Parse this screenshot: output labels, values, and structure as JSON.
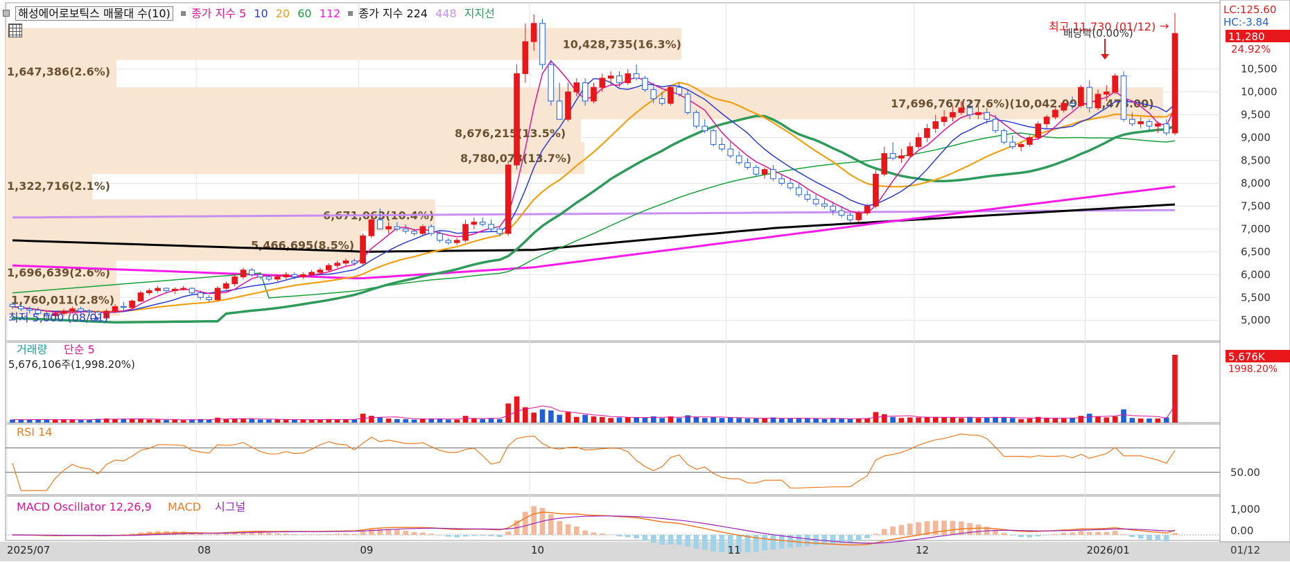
{
  "header": {
    "title": "해성에어로보틱스 매물대 수(10)",
    "ma_label": "종가 지수",
    "ma_periods": [
      "5",
      "10",
      "20",
      "60",
      "112"
    ],
    "ma2_label": "종가 지수",
    "ma2_periods": [
      "224",
      "448"
    ],
    "support_label": "지지선"
  },
  "colors": {
    "bull": "#e8171b",
    "bear": "#1f5fd8",
    "profile": "#f8e6d2",
    "ma5": "#e0119a",
    "ma10": "#2a3bd6",
    "ma20": "#f0a010",
    "ma60": "#16a03a",
    "ma112": "#f81ae8",
    "ma224": "#000000",
    "ma448": "#c78ff0",
    "support": "#2e9b5a",
    "grid": "#e3e3e3",
    "axis_bg": "#d9d9d9"
  },
  "right_axis": {
    "lc": "LC:125.60",
    "hc": "HC:-3.84",
    "last_price": "11,280",
    "last_change": "24.92%",
    "ticks": [
      "10,500",
      "10,000",
      "9,500",
      "9,000",
      "8,500",
      "8,000",
      "7,500",
      "7,000",
      "6,500",
      "6,000",
      "5,500",
      "5,000"
    ]
  },
  "annotations": {
    "high": "최고 11,730 (01/12)",
    "low": "최저 5,000 (08/01)",
    "dividend": "배당락(0.00%)"
  },
  "volume_profile": [
    {
      "label": "10,428,735(16.3%)"
    },
    {
      "label": "1,647,386(2.6%)"
    },
    {
      "label": "17,696,767(27.6%)(10,042.00 ~ 9,478.00)"
    },
    {
      "label": "8,676,215(13.5%)"
    },
    {
      "label": "8,780,073(13.7%)"
    },
    {
      "label": "1,322,716(2.1%)"
    },
    {
      "label": "6,671,063(10.4%)"
    },
    {
      "label": "5,466,695(8.5%)"
    },
    {
      "label": "1,696,639(2.6%)"
    },
    {
      "label": "1,760,011(2.8%)"
    }
  ],
  "volume_panel": {
    "title": "거래량",
    "ma_label": "단순 5",
    "value": "5,676,106주(1,998.20%)",
    "badge": "5,676K",
    "badge_pct": "1998.20%"
  },
  "rsi_panel": {
    "title": "RSI 14",
    "tick": "50.00"
  },
  "macd_panel": {
    "title": "MACD Oscillator 12,26,9",
    "macd_label": "MACD",
    "signal_label": "시그널",
    "ticks": [
      "1,000",
      "0.00"
    ]
  },
  "x_axis": {
    "labels": [
      "2025/07",
      "08",
      "09",
      "10",
      "11",
      "12",
      "2026/01"
    ],
    "end_label": "01/12"
  },
  "chart_data": {
    "type": "candlestick",
    "y_range": [
      4700,
      11800
    ],
    "candles": [
      [
        5350,
        5400,
        5250,
        5300
      ],
      [
        5300,
        5350,
        5200,
        5250
      ],
      [
        5250,
        5300,
        5150,
        5220
      ],
      [
        5220,
        5280,
        5100,
        5150
      ],
      [
        5150,
        5200,
        5050,
        5100
      ],
      [
        5100,
        5180,
        5050,
        5150
      ],
      [
        5150,
        5250,
        5100,
        5200
      ],
      [
        5200,
        5300,
        5150,
        5250
      ],
      [
        5250,
        5300,
        5150,
        5200
      ],
      [
        5200,
        5250,
        5100,
        5180
      ],
      [
        5180,
        5220,
        5000,
        5050
      ],
      [
        5050,
        5250,
        5000,
        5200
      ],
      [
        5200,
        5350,
        5150,
        5300
      ],
      [
        5300,
        5400,
        5200,
        5280
      ],
      [
        5280,
        5450,
        5250,
        5420
      ],
      [
        5420,
        5650,
        5400,
        5600
      ],
      [
        5600,
        5700,
        5550,
        5650
      ],
      [
        5650,
        5750,
        5600,
        5700
      ],
      [
        5700,
        5720,
        5600,
        5650
      ],
      [
        5650,
        5720,
        5580,
        5680
      ],
      [
        5680,
        5750,
        5650,
        5700
      ],
      [
        5700,
        5720,
        5550,
        5600
      ],
      [
        5600,
        5650,
        5450,
        5500
      ],
      [
        5500,
        5550,
        5400,
        5450
      ],
      [
        5450,
        5750,
        5420,
        5700
      ],
      [
        5700,
        5850,
        5650,
        5800
      ],
      [
        5800,
        6000,
        5750,
        5950
      ],
      [
        5950,
        6150,
        5900,
        6100
      ],
      [
        6100,
        6150,
        5950,
        6000
      ],
      [
        6000,
        6050,
        5900,
        5950
      ],
      [
        5950,
        6000,
        5850,
        5900
      ],
      [
        5900,
        6000,
        5850,
        5950
      ],
      [
        5950,
        6050,
        5900,
        6000
      ],
      [
        6000,
        6050,
        5900,
        5950
      ],
      [
        5950,
        6050,
        5900,
        6000
      ],
      [
        6000,
        6100,
        5950,
        6050
      ],
      [
        6050,
        6150,
        6000,
        6100
      ],
      [
        6100,
        6250,
        6050,
        6200
      ],
      [
        6200,
        6300,
        6150,
        6250
      ],
      [
        6250,
        6350,
        6200,
        6300
      ],
      [
        6300,
        6350,
        6200,
        6250
      ],
      [
        6250,
        6900,
        6200,
        6850
      ],
      [
        6850,
        7300,
        6800,
        7200
      ],
      [
        7200,
        7450,
        7100,
        7000
      ],
      [
        7000,
        7150,
        6900,
        7050
      ],
      [
        7050,
        7150,
        6950,
        7000
      ],
      [
        7000,
        7100,
        6900,
        6950
      ],
      [
        6950,
        7000,
        6850,
        6900
      ],
      [
        6900,
        7100,
        6850,
        7050
      ],
      [
        7050,
        7100,
        6850,
        6900
      ],
      [
        6900,
        6950,
        6700,
        6750
      ],
      [
        6750,
        6800,
        6650,
        6700
      ],
      [
        6700,
        6800,
        6650,
        6750
      ],
      [
        6750,
        7200,
        6700,
        7100
      ],
      [
        7100,
        7250,
        7000,
        7150
      ],
      [
        7150,
        7250,
        7050,
        7100
      ],
      [
        7100,
        7200,
        6950,
        7000
      ],
      [
        7000,
        7050,
        6850,
        6900
      ],
      [
        6900,
        8500,
        6850,
        8400
      ],
      [
        8400,
        10600,
        8300,
        10400
      ],
      [
        10400,
        11500,
        10200,
        11100
      ],
      [
        11100,
        11700,
        10900,
        11500
      ],
      [
        11500,
        11600,
        10500,
        10600
      ],
      [
        10600,
        10700,
        9700,
        9800
      ],
      [
        9800,
        10200,
        9600,
        9400
      ],
      [
        9400,
        10200,
        9350,
        10000
      ],
      [
        10000,
        10300,
        9900,
        10200
      ],
      [
        10200,
        10300,
        9700,
        9800
      ],
      [
        9800,
        10200,
        9750,
        10100
      ],
      [
        10100,
        10400,
        10000,
        10300
      ],
      [
        10300,
        10450,
        10150,
        10350
      ],
      [
        10350,
        10450,
        10100,
        10200
      ],
      [
        10200,
        10500,
        10150,
        10400
      ],
      [
        10400,
        10600,
        10250,
        10300
      ],
      [
        10300,
        10350,
        10000,
        10050
      ],
      [
        10050,
        10200,
        9750,
        9850
      ],
      [
        9850,
        10000,
        9700,
        9750
      ],
      [
        9750,
        10150,
        9700,
        10100
      ],
      [
        10100,
        10200,
        9900,
        9950
      ],
      [
        9950,
        10050,
        9500,
        9550
      ],
      [
        9550,
        9600,
        9200,
        9250
      ],
      [
        9250,
        9400,
        9100,
        9150
      ],
      [
        9150,
        9200,
        8800,
        8850
      ],
      [
        8850,
        9000,
        8700,
        8750
      ],
      [
        8750,
        8900,
        8550,
        8600
      ],
      [
        8600,
        8700,
        8400,
        8450
      ],
      [
        8450,
        8550,
        8300,
        8350
      ],
      [
        8350,
        8400,
        8150,
        8200
      ],
      [
        8200,
        8350,
        8100,
        8300
      ],
      [
        8300,
        8400,
        8050,
        8100
      ],
      [
        8100,
        8200,
        7950,
        8000
      ],
      [
        8000,
        8100,
        7850,
        7900
      ],
      [
        7900,
        8000,
        7700,
        7750
      ],
      [
        7750,
        7850,
        7600,
        7650
      ],
      [
        7650,
        7750,
        7500,
        7550
      ],
      [
        7550,
        7650,
        7450,
        7500
      ],
      [
        7500,
        7600,
        7300,
        7400
      ],
      [
        7400,
        7500,
        7250,
        7300
      ],
      [
        7300,
        7350,
        7150,
        7200
      ],
      [
        7200,
        7400,
        7150,
        7350
      ],
      [
        7350,
        7550,
        7300,
        7500
      ],
      [
        7500,
        8300,
        7450,
        8200
      ],
      [
        8200,
        8800,
        8150,
        8650
      ],
      [
        8650,
        8900,
        8500,
        8550
      ],
      [
        8550,
        8750,
        8450,
        8600
      ],
      [
        8600,
        8900,
        8550,
        8800
      ],
      [
        8800,
        9100,
        8750,
        9000
      ],
      [
        9000,
        9300,
        8900,
        9200
      ],
      [
        9200,
        9500,
        9100,
        9350
      ],
      [
        9350,
        9600,
        9250,
        9450
      ],
      [
        9450,
        9700,
        9350,
        9550
      ],
      [
        9550,
        9800,
        9500,
        9650
      ],
      [
        9650,
        9800,
        9400,
        9500
      ],
      [
        9500,
        9700,
        9400,
        9550
      ],
      [
        9550,
        9650,
        9300,
        9400
      ],
      [
        9400,
        9500,
        9100,
        9150
      ],
      [
        9150,
        9200,
        8850,
        8900
      ],
      [
        8900,
        9050,
        8750,
        8800
      ],
      [
        8800,
        8900,
        8700,
        8850
      ],
      [
        8850,
        9050,
        8800,
        9000
      ],
      [
        9000,
        9350,
        8950,
        9300
      ],
      [
        9300,
        9500,
        9200,
        9450
      ],
      [
        9450,
        9650,
        9400,
        9600
      ],
      [
        9600,
        9800,
        9550,
        9750
      ],
      [
        9750,
        9900,
        9600,
        9700
      ],
      [
        9700,
        10150,
        9650,
        10100
      ],
      [
        10100,
        10250,
        9550,
        9650
      ],
      [
        9650,
        10050,
        9600,
        9950
      ],
      [
        9950,
        10150,
        9800,
        10000
      ],
      [
        10000,
        10400,
        9950,
        10350
      ],
      [
        10350,
        10450,
        9350,
        9400
      ],
      [
        9400,
        9550,
        9250,
        9300
      ],
      [
        9300,
        9450,
        9200,
        9350
      ],
      [
        9350,
        9400,
        9150,
        9250
      ],
      [
        9250,
        9350,
        9100,
        9300
      ],
      [
        9300,
        9400,
        9050,
        9100
      ],
      [
        9100,
        11730,
        9050,
        11280
      ]
    ],
    "volume_max": 5676106
  }
}
